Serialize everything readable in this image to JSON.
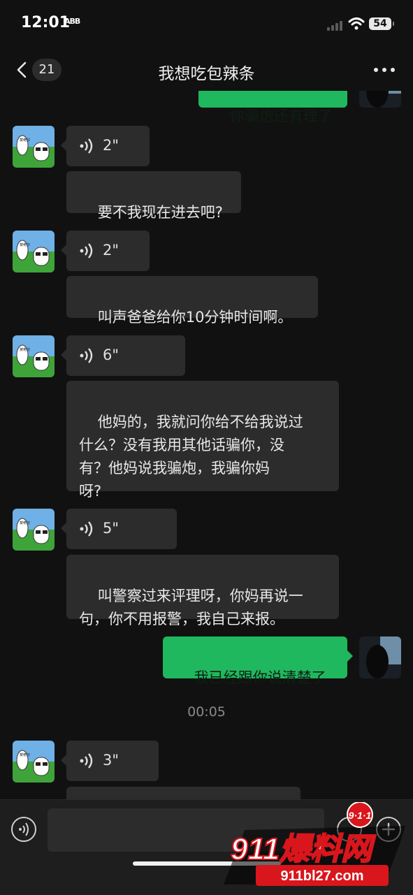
{
  "status_bar": {
    "time": "12:01",
    "mini_label": "ABB",
    "battery": "54"
  },
  "header": {
    "back_count": "21",
    "title": "我想吃包辣条"
  },
  "messages": [
    {
      "kind": "text",
      "direction": "out",
      "text": "你骗炮还有理了"
    },
    {
      "kind": "voice",
      "direction": "in",
      "duration": "2\""
    },
    {
      "kind": "text",
      "direction": "in",
      "text": "要不我现在进去吧?"
    },
    {
      "kind": "voice",
      "direction": "in",
      "duration": "2\""
    },
    {
      "kind": "text",
      "direction": "in",
      "text": "叫声爸爸给你10分钟时间啊。"
    },
    {
      "kind": "voice",
      "direction": "in",
      "duration": "6\""
    },
    {
      "kind": "text",
      "direction": "in",
      "text": "他妈的，我就问你给不给我说过\n什么？没有我用其他话骗你，没\n有？他妈说我骗炮，我骗你妈\n呀?"
    },
    {
      "kind": "voice",
      "direction": "in",
      "duration": "5\""
    },
    {
      "kind": "text",
      "direction": "in",
      "text": "叫警察过来评理呀，你妈再说一\n句，你不用报警，我自己来报。"
    },
    {
      "kind": "text",
      "direction": "out",
      "text": "我已经跟你说清楚了"
    },
    {
      "kind": "time",
      "text": "00:05"
    },
    {
      "kind": "voice",
      "direction": "in",
      "duration": "3\""
    }
  ],
  "avatar_text": "禁佬仔",
  "watermark": {
    "badge": "9·1·1",
    "brand": "911爆料网",
    "url": "911bl27.com"
  },
  "colors": {
    "background": "#111111",
    "incoming_bubble": "#2c2c2c",
    "outgoing_bubble": "#1fb85e",
    "watermark_red": "#d9161c"
  }
}
